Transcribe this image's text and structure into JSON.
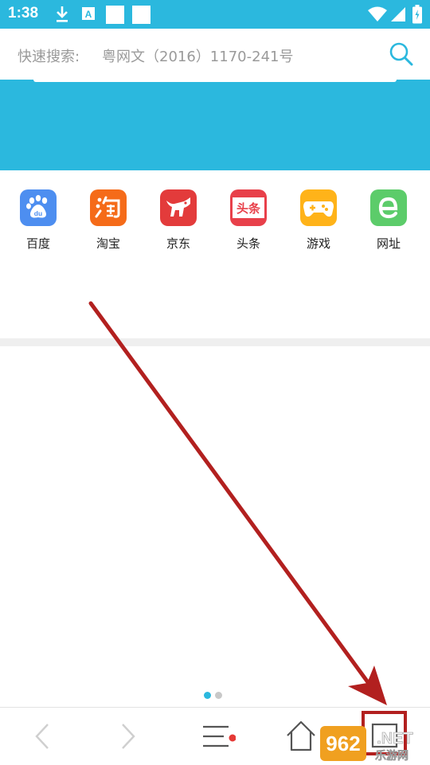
{
  "status_bar": {
    "time": "1:38",
    "icons": [
      "download-icon",
      "notification-a-icon",
      "square-icon",
      "square-icon",
      "wifi-icon",
      "signal-icon",
      "battery-icon"
    ],
    "color": "#2bb8de"
  },
  "search": {
    "label": "快速搜索:",
    "value": "粤网文（2016）1170-241号",
    "icon": "search-icon"
  },
  "quick_links": [
    {
      "label": "百度",
      "icon": "baidu-icon",
      "color": "#4d8ef0"
    },
    {
      "label": "淘宝",
      "icon": "taobao-icon",
      "color": "#f56b19"
    },
    {
      "label": "京东",
      "icon": "jd-icon",
      "color": "#e33b3b"
    },
    {
      "label": "头条",
      "icon": "toutiao-icon",
      "color": "#e8404a"
    },
    {
      "label": "游戏",
      "icon": "game-icon",
      "color": "#ffb319"
    },
    {
      "label": "网址",
      "icon": "url-icon",
      "color": "#5ccc6a"
    }
  ],
  "page_indicator": {
    "total": 2,
    "current": 1,
    "active_color": "#2bb8de",
    "inactive_color": "#c8c8c8"
  },
  "bottom_bar": {
    "buttons": [
      {
        "icon": "back-icon",
        "enabled": false
      },
      {
        "icon": "forward-icon",
        "enabled": false
      },
      {
        "icon": "menu-icon",
        "has_badge": true,
        "badge_color": "#e53935"
      },
      {
        "icon": "home-icon"
      },
      {
        "icon": "tabs-icon"
      }
    ]
  },
  "annotation": {
    "color": "#b2201f"
  },
  "watermark": {
    "line1": "962.NET",
    "line2": "乐游网"
  }
}
